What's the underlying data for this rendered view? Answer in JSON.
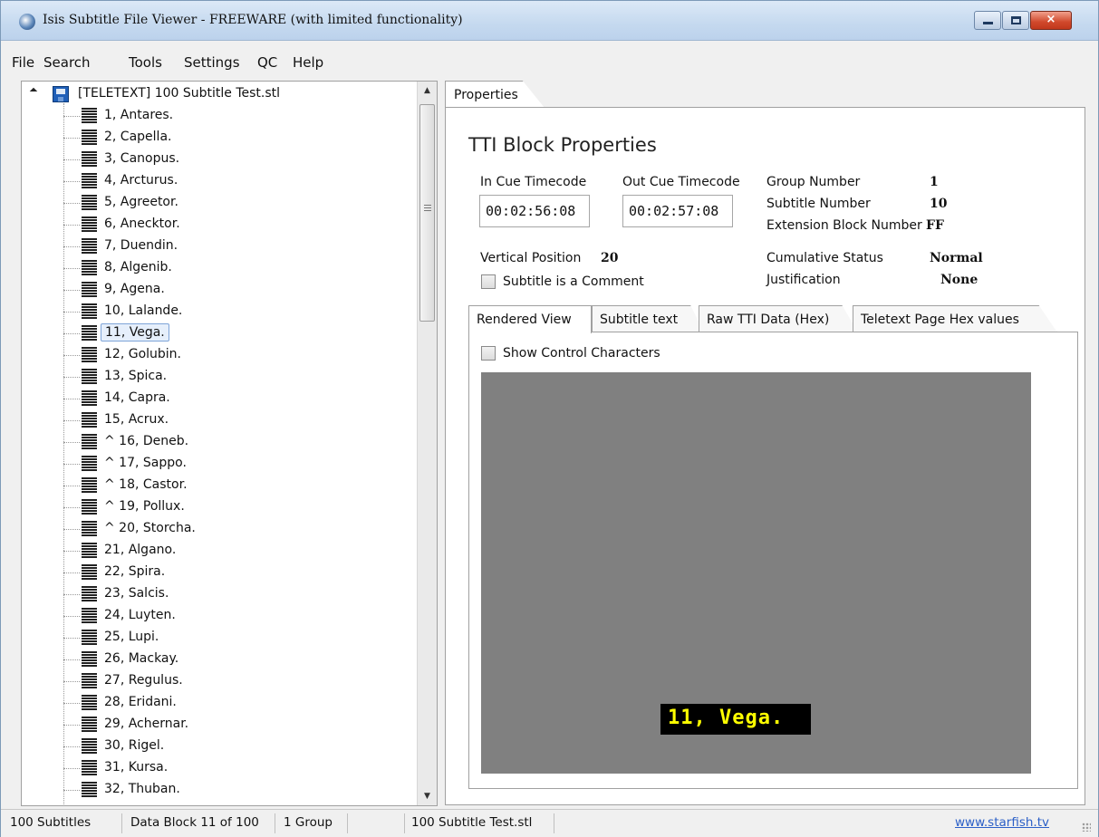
{
  "window": {
    "title": "Isis Subtitle File Viewer - FREEWARE (with limited functionality)",
    "controls": {
      "minimize": "minimize-icon",
      "maximize": "maximize-icon",
      "close": "×"
    }
  },
  "menu": [
    "File",
    "Search",
    "Tools",
    "Settings",
    "QC",
    "Help"
  ],
  "tree": {
    "root_label": "[TELETEXT] 100 Subtitle Test.stl",
    "items": [
      "1, Antares.",
      "2, Capella.",
      "3, Canopus.",
      "4, Arcturus.",
      "5, Agreetor.",
      "6, Anecktor.",
      "7, Duendin.",
      "8, Algenib.",
      "9, Agena.",
      "10, Lalande.",
      "11, Vega.",
      "12, Golubin.",
      "13, Spica.",
      "14, Capra.",
      "15, Acrux.",
      "^ 16, Deneb.",
      "^ 17, Sappo.",
      "^ 18, Castor.",
      "^ 19, Pollux.",
      "^ 20, Storcha.",
      "21, Algano.",
      "22, Spira.",
      "23, Salcis.",
      "24, Luyten.",
      "25, Lupi.",
      "26, Mackay.",
      "27, Regulus.",
      "28, Eridani.",
      "29, Achernar.",
      "30, Rigel.",
      "31, Kursa.",
      "32, Thuban."
    ],
    "selected_index": 10
  },
  "properties": {
    "tab_label": "Properties",
    "section_title": "TTI Block Properties",
    "in_cue_label": "In Cue Timecode",
    "in_cue_value": "00:02:56:08",
    "out_cue_label": "Out Cue Timecode",
    "out_cue_value": "00:02:57:08",
    "group_number_label": "Group Number",
    "group_number_value": "1",
    "subtitle_number_label": "Subtitle Number",
    "subtitle_number_value": "10",
    "extension_block_label": "Extension Block Number",
    "extension_block_value": "FF",
    "vertical_position_label": "Vertical Position",
    "vertical_position_value": "20",
    "comment_label": "Subtitle is a Comment",
    "comment_checked": false,
    "cumulative_status_label": "Cumulative Status",
    "cumulative_status_value": "Normal",
    "justification_label": "Justification",
    "justification_value": "None"
  },
  "inner_tabs": [
    {
      "label": "Rendered View",
      "active": true
    },
    {
      "label": "Subtitle text",
      "active": false
    },
    {
      "label": "Raw TTI Data (Hex)",
      "active": false
    },
    {
      "label": "Teletext Page Hex values",
      "active": false
    }
  ],
  "rendered_view": {
    "show_control_chars_label": "Show Control Characters",
    "show_control_chars_checked": false,
    "rendered_text": "11, Vega.",
    "background_color": "#808080",
    "text_color": "#ffff00",
    "text_background": "#000000"
  },
  "status": {
    "subtitles": "100 Subtitles",
    "data_block": "Data Block 11 of 100",
    "groups": "1 Group",
    "filename": "100 Subtitle Test.stl",
    "link": "www.starfish.tv"
  }
}
